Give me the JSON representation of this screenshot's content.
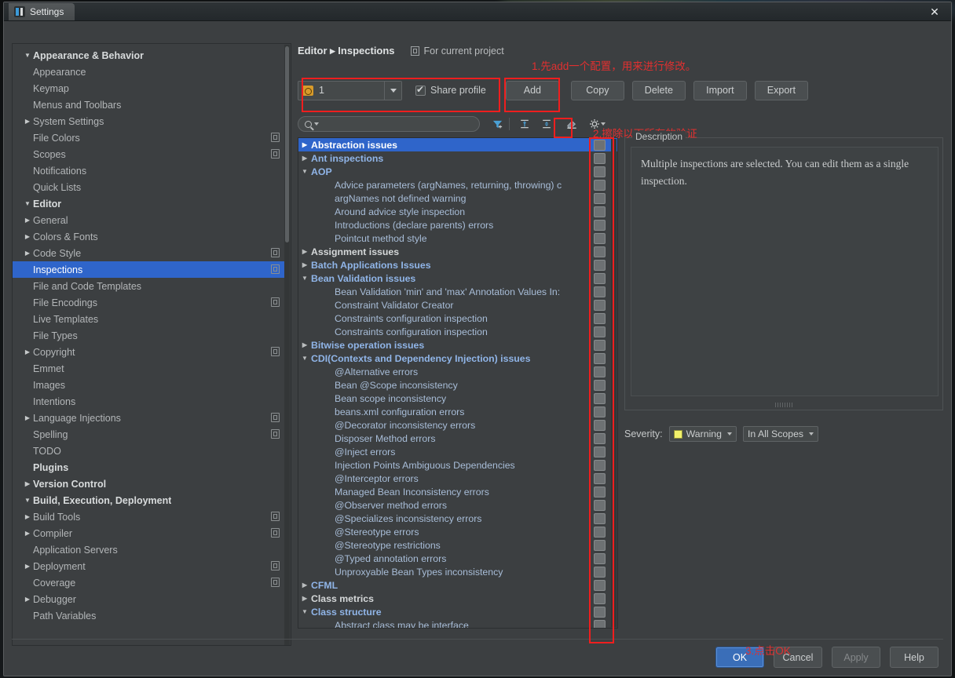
{
  "window": {
    "title": "Settings",
    "close_label": "✕"
  },
  "sidebar": {
    "search_placeholder": "",
    "search_value": "",
    "items": [
      {
        "label": "Appearance & Behavior",
        "level": 0,
        "group": true,
        "twisty": "▼",
        "copy": false
      },
      {
        "label": "Appearance",
        "level": 1,
        "group": false,
        "twisty": "",
        "copy": false
      },
      {
        "label": "Keymap",
        "level": 1,
        "group": false,
        "twisty": "",
        "copy": false
      },
      {
        "label": "Menus and Toolbars",
        "level": 1,
        "group": false,
        "twisty": "",
        "copy": false
      },
      {
        "label": "System Settings",
        "level": 1,
        "group": false,
        "twisty": "▶",
        "copy": false
      },
      {
        "label": "File Colors",
        "level": 1,
        "group": false,
        "twisty": "",
        "copy": true
      },
      {
        "label": "Scopes",
        "level": 1,
        "group": false,
        "twisty": "",
        "copy": true
      },
      {
        "label": "Notifications",
        "level": 1,
        "group": false,
        "twisty": "",
        "copy": false
      },
      {
        "label": "Quick Lists",
        "level": 1,
        "group": false,
        "twisty": "",
        "copy": false
      },
      {
        "label": "Editor",
        "level": 0,
        "group": true,
        "twisty": "▼",
        "copy": false
      },
      {
        "label": "General",
        "level": 1,
        "group": false,
        "twisty": "▶",
        "copy": false
      },
      {
        "label": "Colors & Fonts",
        "level": 1,
        "group": false,
        "twisty": "▶",
        "copy": false
      },
      {
        "label": "Code Style",
        "level": 1,
        "group": false,
        "twisty": "▶",
        "copy": true
      },
      {
        "label": "Inspections",
        "level": 1,
        "group": false,
        "twisty": "",
        "copy": true,
        "selected": true
      },
      {
        "label": "File and Code Templates",
        "level": 1,
        "group": false,
        "twisty": "",
        "copy": false
      },
      {
        "label": "File Encodings",
        "level": 1,
        "group": false,
        "twisty": "",
        "copy": true
      },
      {
        "label": "Live Templates",
        "level": 1,
        "group": false,
        "twisty": "",
        "copy": false
      },
      {
        "label": "File Types",
        "level": 1,
        "group": false,
        "twisty": "",
        "copy": false
      },
      {
        "label": "Copyright",
        "level": 1,
        "group": false,
        "twisty": "▶",
        "copy": true
      },
      {
        "label": "Emmet",
        "level": 1,
        "group": false,
        "twisty": "",
        "copy": false
      },
      {
        "label": "Images",
        "level": 1,
        "group": false,
        "twisty": "",
        "copy": false
      },
      {
        "label": "Intentions",
        "level": 1,
        "group": false,
        "twisty": "",
        "copy": false
      },
      {
        "label": "Language Injections",
        "level": 1,
        "group": false,
        "twisty": "▶",
        "copy": true
      },
      {
        "label": "Spelling",
        "level": 1,
        "group": false,
        "twisty": "",
        "copy": true
      },
      {
        "label": "TODO",
        "level": 1,
        "group": false,
        "twisty": "",
        "copy": false
      },
      {
        "label": "Plugins",
        "level": 0,
        "group": true,
        "twisty": "",
        "copy": false
      },
      {
        "label": "Version Control",
        "level": 0,
        "group": true,
        "twisty": "▶",
        "copy": false
      },
      {
        "label": "Build, Execution, Deployment",
        "level": 0,
        "group": true,
        "twisty": "▼",
        "copy": false
      },
      {
        "label": "Build Tools",
        "level": 1,
        "group": false,
        "twisty": "▶",
        "copy": true
      },
      {
        "label": "Compiler",
        "level": 1,
        "group": false,
        "twisty": "▶",
        "copy": true
      },
      {
        "label": "Application Servers",
        "level": 1,
        "group": false,
        "twisty": "",
        "copy": false
      },
      {
        "label": "Deployment",
        "level": 1,
        "group": false,
        "twisty": "▶",
        "copy": true
      },
      {
        "label": "Coverage",
        "level": 1,
        "group": false,
        "twisty": "",
        "copy": true
      },
      {
        "label": "Debugger",
        "level": 1,
        "group": false,
        "twisty": "▶",
        "copy": false
      },
      {
        "label": "Path Variables",
        "level": 1,
        "group": false,
        "twisty": "",
        "copy": false
      }
    ]
  },
  "main": {
    "breadcrumb_path": "Editor ▸ Inspections",
    "breadcrumb_project": "For current project",
    "profile_value": "1",
    "share_profile_label": "Share profile",
    "share_profile_checked": true,
    "buttons": {
      "add": "Add",
      "copy": "Copy",
      "delete": "Delete",
      "import": "Import",
      "export": "Export"
    },
    "filter_search_value": "",
    "toolbar_icons": [
      "filter-icon",
      "expand-all-icon",
      "collapse-all-icon",
      "eraser-icon",
      "gear-icon"
    ],
    "inspections": [
      {
        "label": "Abstraction issues",
        "type": "cat-plain",
        "twisty": "▶",
        "selected": true
      },
      {
        "label": "Ant inspections",
        "type": "cat",
        "twisty": "▶"
      },
      {
        "label": "AOP",
        "type": "cat",
        "twisty": "▼"
      },
      {
        "label": "Advice parameters (argNames, returning, throwing) c",
        "type": "leaf"
      },
      {
        "label": "argNames not defined warning",
        "type": "leaf"
      },
      {
        "label": "Around advice style inspection",
        "type": "leaf"
      },
      {
        "label": "Introductions (declare parents) errors",
        "type": "leaf"
      },
      {
        "label": "Pointcut method style",
        "type": "leaf"
      },
      {
        "label": "Assignment issues",
        "type": "cat-plain",
        "twisty": "▶"
      },
      {
        "label": "Batch Applications Issues",
        "type": "cat",
        "twisty": "▶"
      },
      {
        "label": "Bean Validation issues",
        "type": "cat",
        "twisty": "▼"
      },
      {
        "label": "Bean Validation 'min' and 'max' Annotation Values In:",
        "type": "leaf"
      },
      {
        "label": "Constraint Validator Creator",
        "type": "leaf"
      },
      {
        "label": "Constraints configuration inspection",
        "type": "leaf"
      },
      {
        "label": "Constraints configuration inspection",
        "type": "leaf"
      },
      {
        "label": "Bitwise operation issues",
        "type": "cat",
        "twisty": "▶"
      },
      {
        "label": "CDI(Contexts and Dependency Injection) issues",
        "type": "cat",
        "twisty": "▼"
      },
      {
        "label": "@Alternative errors",
        "type": "leaf"
      },
      {
        "label": "Bean @Scope inconsistency",
        "type": "leaf"
      },
      {
        "label": "Bean scope inconsistency",
        "type": "leaf"
      },
      {
        "label": "beans.xml configuration errors",
        "type": "leaf"
      },
      {
        "label": "@Decorator inconsistency errors",
        "type": "leaf"
      },
      {
        "label": "Disposer Method errors",
        "type": "leaf"
      },
      {
        "label": "@Inject errors",
        "type": "leaf"
      },
      {
        "label": "Injection Points Ambiguous Dependencies",
        "type": "leaf"
      },
      {
        "label": "@Interceptor errors",
        "type": "leaf"
      },
      {
        "label": "Managed Bean Inconsistency errors",
        "type": "leaf"
      },
      {
        "label": "@Observer method errors",
        "type": "leaf"
      },
      {
        "label": "@Specializes inconsistency errors",
        "type": "leaf"
      },
      {
        "label": "@Stereotype errors",
        "type": "leaf"
      },
      {
        "label": "@Stereotype restrictions",
        "type": "leaf"
      },
      {
        "label": "@Typed annotation errors",
        "type": "leaf"
      },
      {
        "label": "Unproxyable Bean Types inconsistency",
        "type": "leaf"
      },
      {
        "label": "CFML",
        "type": "cat",
        "twisty": "▶"
      },
      {
        "label": "Class metrics",
        "type": "cat-plain",
        "twisty": "▶"
      },
      {
        "label": "Class structure",
        "type": "cat",
        "twisty": "▼"
      },
      {
        "label": "Abstract class may be interface",
        "type": "leaf"
      }
    ],
    "description": {
      "legend": "Description",
      "text": "Multiple inspections are selected. You can edit them as a single inspection."
    },
    "severity": {
      "label": "Severity:",
      "value": "Warning",
      "color": "#f2f26b",
      "scope": "In All Scopes"
    }
  },
  "footer": {
    "ok": "OK",
    "cancel": "Cancel",
    "apply": "Apply",
    "help": "Help"
  },
  "annotations": [
    {
      "id": "a1",
      "text": "1.先add一个配置，用来进行修改。"
    },
    {
      "id": "a2",
      "text": "2.擦除以下所有的验证"
    },
    {
      "id": "a3",
      "text": "3.点击OK"
    }
  ],
  "colors": {
    "accent_blue": "#2f65ca",
    "annotation_red": "#e03030",
    "severity_yellow": "#f2f26b"
  }
}
